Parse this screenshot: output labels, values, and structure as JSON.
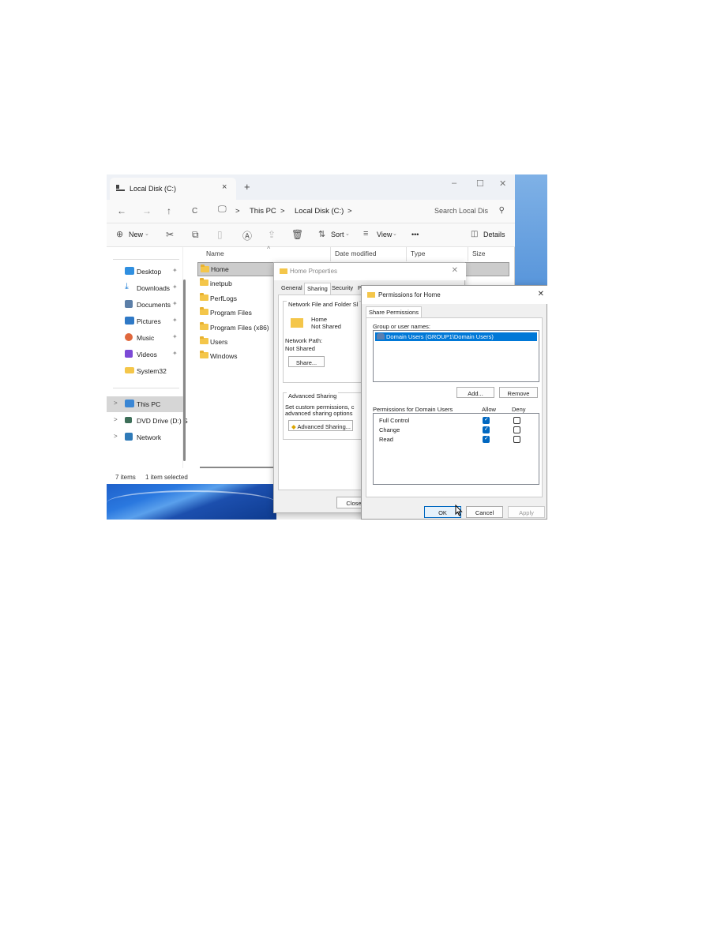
{
  "explorer": {
    "tab_title": "Local Disk (C:)",
    "tab_close": "×",
    "new_tab": "+",
    "window_buttons": {
      "minimize": "–",
      "maximize": "☐",
      "close": "✕"
    },
    "nav": {
      "back": "←",
      "forward": "→",
      "up": "↑",
      "refresh": "C"
    },
    "breadcrumb": [
      "This PC",
      "Local Disk (C:)"
    ],
    "breadcrumb_sep": ">",
    "search_placeholder": "Search Local Dis",
    "toolbar": {
      "new_label": "New",
      "sort_label": "Sort",
      "view_label": "View",
      "more_label": "•••",
      "details_label": "Details"
    },
    "sidebar": {
      "quick_access": [
        {
          "label": "Desktop",
          "icon": "desktop-icon",
          "color": "#2f8fe0"
        },
        {
          "label": "Downloads",
          "icon": "download-icon",
          "color": "#1a7bd6"
        },
        {
          "label": "Documents",
          "icon": "documents-icon",
          "color": "#5c7fa8"
        },
        {
          "label": "Pictures",
          "icon": "pictures-icon",
          "color": "#2f79c6"
        },
        {
          "label": "Music",
          "icon": "music-icon",
          "color": "#e0683d"
        },
        {
          "label": "Videos",
          "icon": "videos-icon",
          "color": "#7c4ad6"
        },
        {
          "label": "System32",
          "icon": "folder-icon",
          "color": "#f4c64a"
        }
      ],
      "devices": [
        {
          "label": "This PC",
          "icon": "computer-icon",
          "color": "#3a86d4"
        },
        {
          "label": "DVD Drive (D:) S",
          "icon": "dvd-icon",
          "color": "#3d6e58"
        },
        {
          "label": "Network",
          "icon": "network-icon",
          "color": "#2f7ab8"
        }
      ]
    },
    "columns": {
      "name": "Name",
      "date_modified": "Date modified",
      "type": "Type",
      "size": "Size"
    },
    "files": [
      "Home",
      "inetpub",
      "PerfLogs",
      "Program Files",
      "Program Files (x86)",
      "Users",
      "Windows"
    ],
    "status": {
      "count": "7 items",
      "selected": "1 item selected"
    }
  },
  "properties_dialog": {
    "title": "Home Properties",
    "close": "✕",
    "tabs": [
      "General",
      "Sharing",
      "Security",
      "P"
    ],
    "group_network": "Network File and Folder Sl",
    "share_name": "Home",
    "share_status": "Not Shared",
    "network_path_label": "Network Path:",
    "network_path_value": "Not Shared",
    "share_button": "Share...",
    "group_advanced": "Advanced Sharing",
    "advanced_text_1": "Set custom permissions, c",
    "advanced_text_2": "advanced sharing options",
    "advanced_button": "Advanced Sharing...",
    "close_button": "Close"
  },
  "permissions_dialog": {
    "title": "Permissions for Home",
    "close": "✕",
    "tab": "Share Permissions",
    "group_label": "Group or user names:",
    "users": [
      "Domain Users (GROUP1\\Domain Users)"
    ],
    "add_button": "Add...",
    "remove_button": "Remove",
    "permissions_for": "Permissions for Domain Users",
    "allow_label": "Allow",
    "deny_label": "Deny",
    "permissions": [
      {
        "label": "Full Control",
        "allow": true,
        "deny": false
      },
      {
        "label": "Change",
        "allow": true,
        "deny": false
      },
      {
        "label": "Read",
        "allow": true,
        "deny": false
      }
    ],
    "ok_button": "OK",
    "cancel_button": "Cancel",
    "apply_button": "Apply"
  }
}
